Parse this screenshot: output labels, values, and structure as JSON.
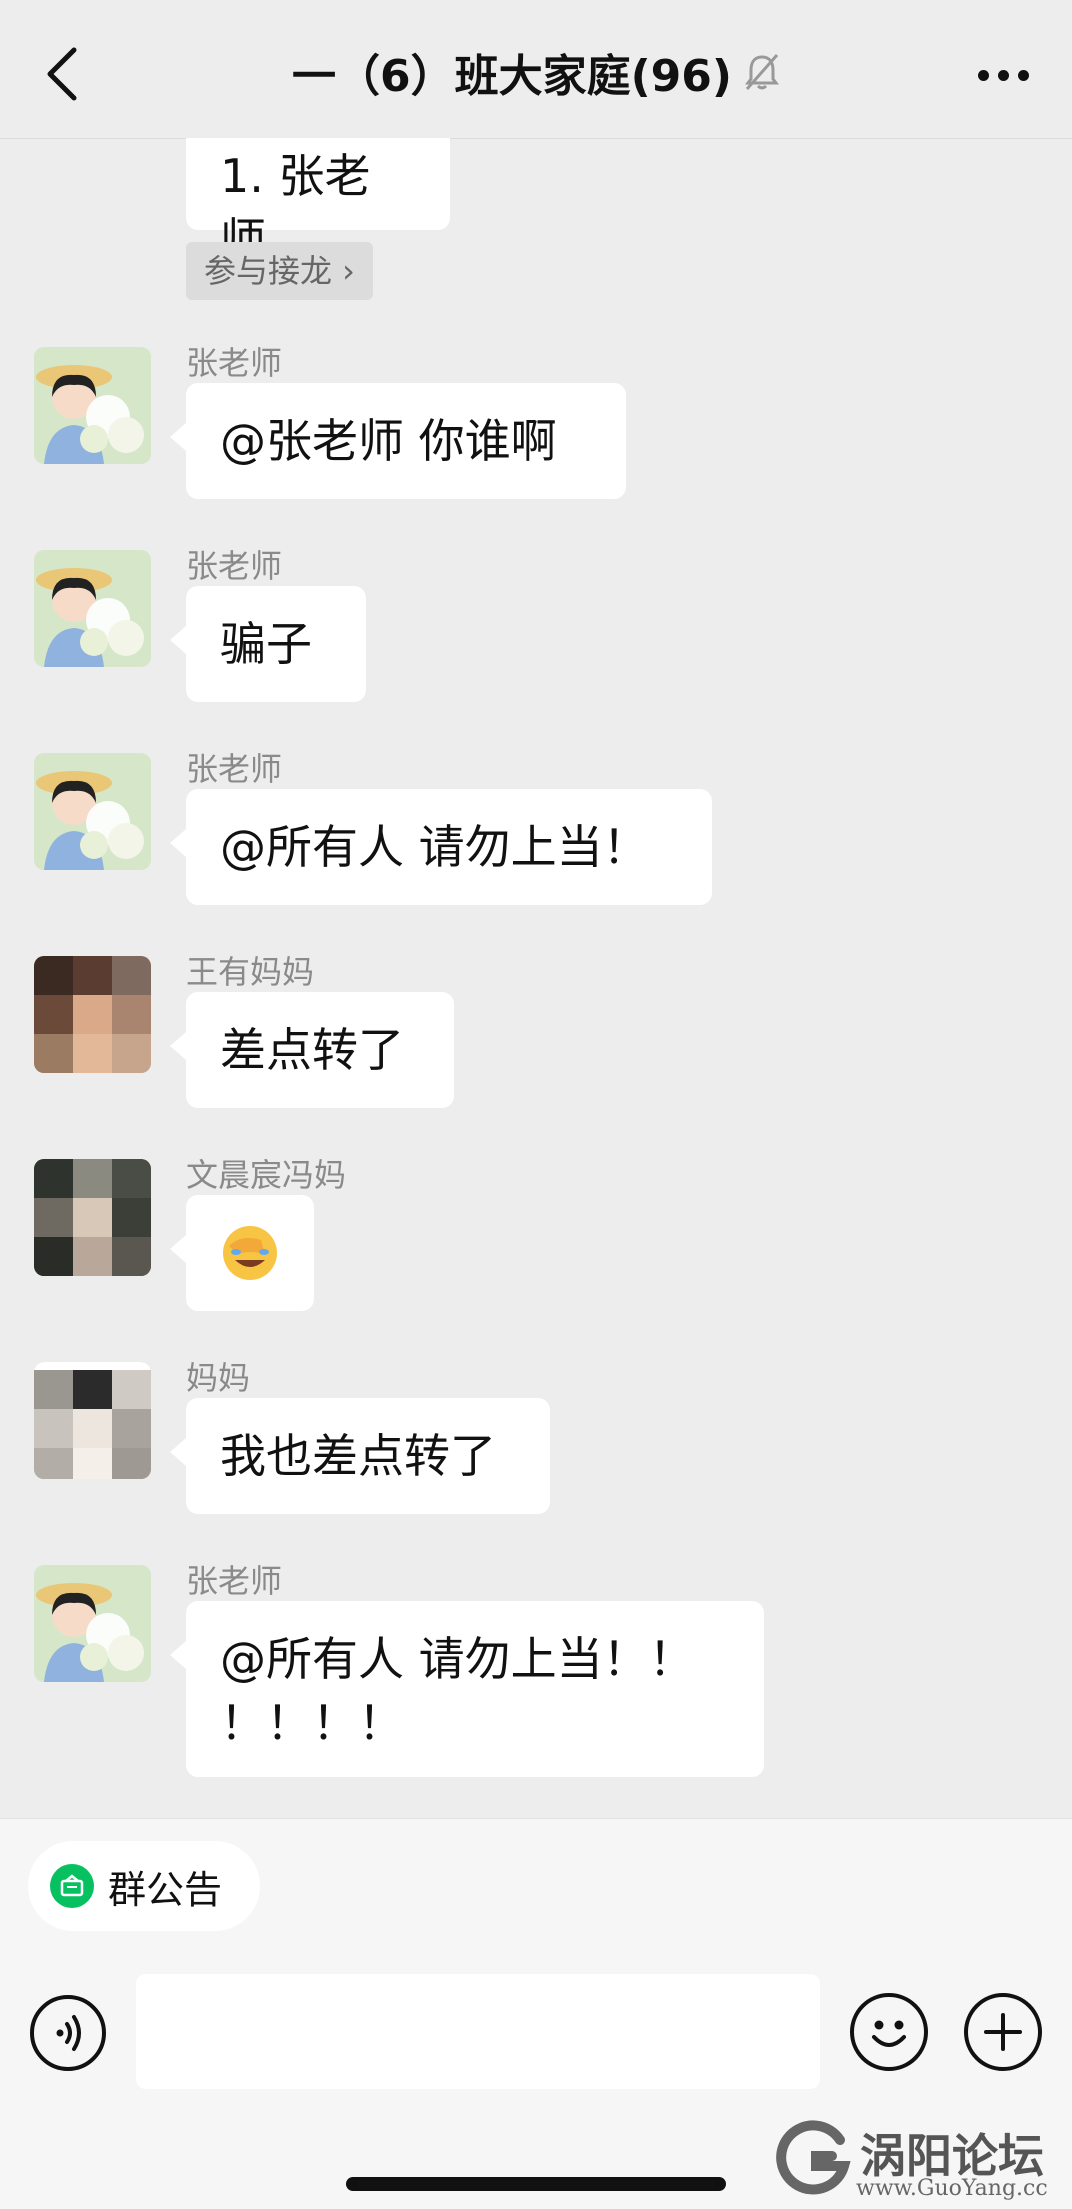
{
  "header": {
    "title": "一（6）班大家庭(96)"
  },
  "messages": {
    "first_bubble": "1. 张老师",
    "join_chip": "参与接龙 ›",
    "m1": {
      "sender": "张老师",
      "text": "@张老师  你谁啊"
    },
    "m2": {
      "sender": "张老师",
      "text": "骗子"
    },
    "m3": {
      "sender": "张老师",
      "text": "@所有人  请勿上当！"
    },
    "m4": {
      "sender": "王有妈妈",
      "text": "差点转了"
    },
    "m5": {
      "sender": "文晨宸冯妈",
      "text": "🤦"
    },
    "m6": {
      "sender": "妈妈",
      "text": "我也差点转了"
    },
    "m7": {
      "sender": "张老师",
      "line1": "@所有人  请勿上当！！",
      "line2": "！！！！"
    }
  },
  "footer": {
    "notice_label": "群公告"
  },
  "watermark": {
    "brand": "涡阳论坛",
    "domain": "www.GuoYang.cc"
  },
  "colors": {
    "background": "#ededed",
    "bubble": "#ffffff",
    "accent_green": "#07c160"
  }
}
